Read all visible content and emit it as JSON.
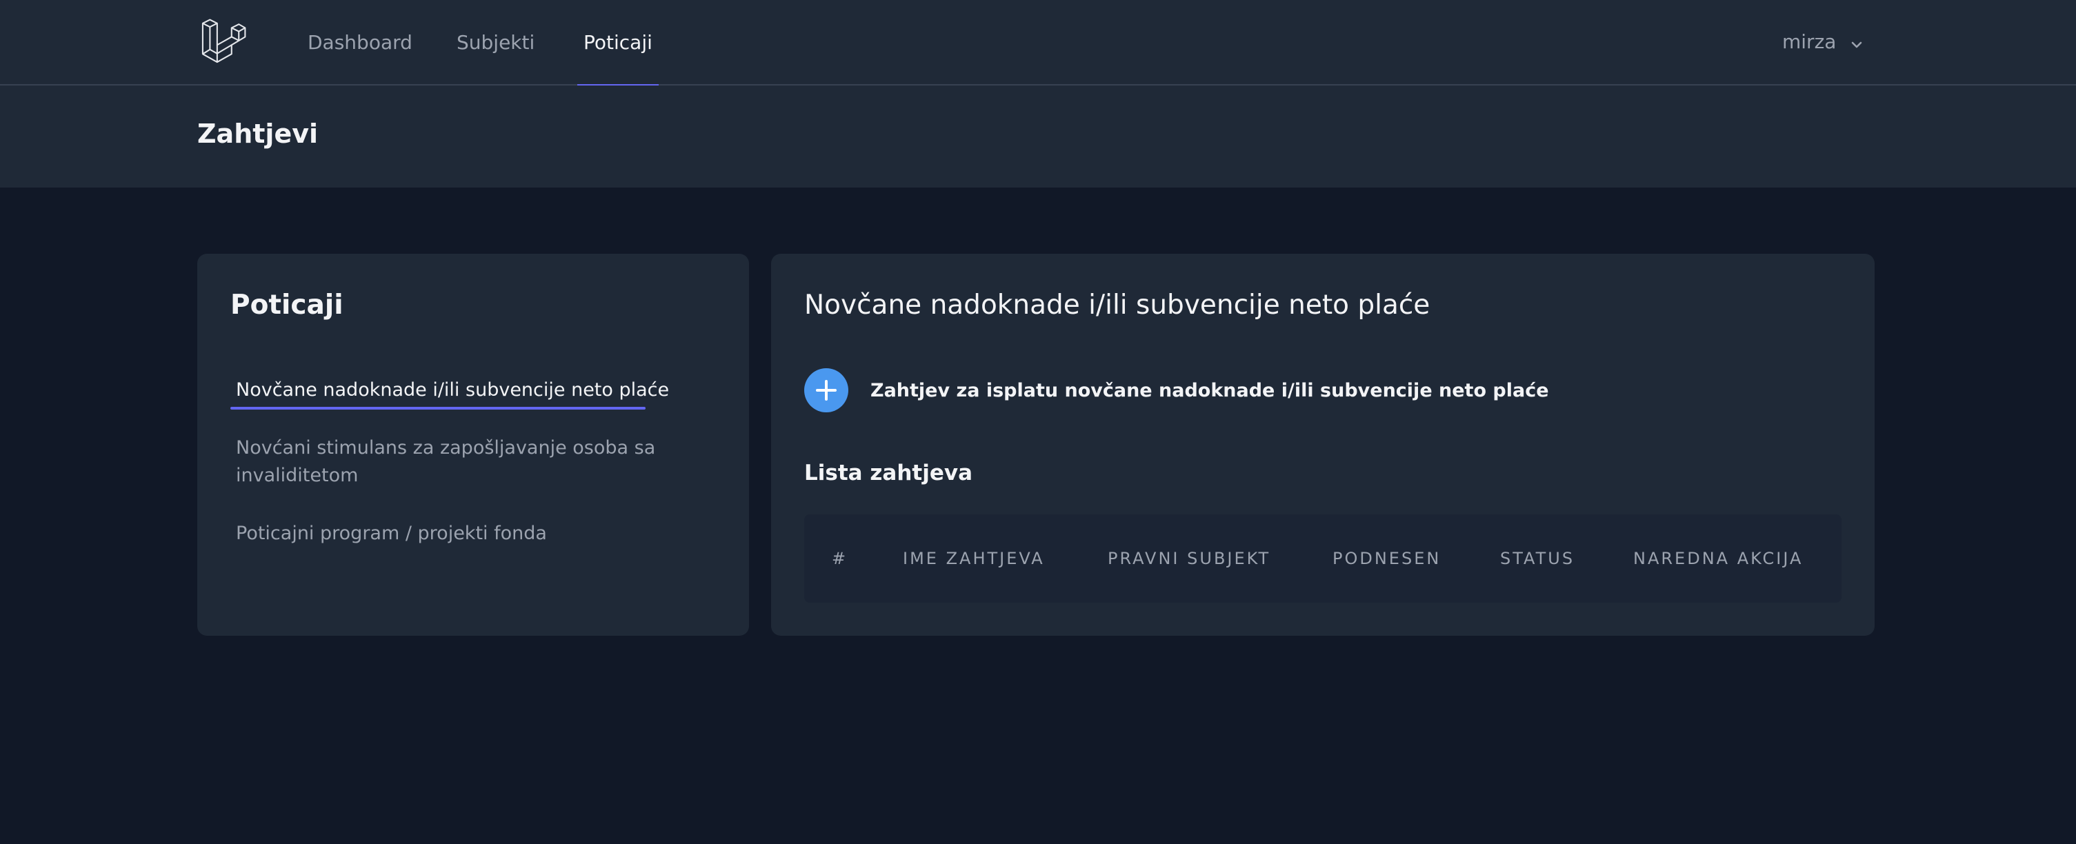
{
  "nav": {
    "links": [
      {
        "label": "Dashboard",
        "active": false
      },
      {
        "label": "Subjekti",
        "active": false
      },
      {
        "label": "Poticaji",
        "active": true
      }
    ],
    "user": "mirza",
    "logo_icon": "laravel-logo-icon"
  },
  "header": {
    "title": "Zahtjevi"
  },
  "sidebar": {
    "title": "Poticaji",
    "items": [
      {
        "label": "Novčane nadoknade i/ili subvencije neto plaće",
        "active": true
      },
      {
        "label": "Novćani stimulans za zapošljavanje osoba sa invaliditetom",
        "active": false
      },
      {
        "label": "Poticajni program / projekti fonda",
        "active": false
      }
    ]
  },
  "main": {
    "title": "Novčane nadoknade i/ili subvencije neto plaće",
    "add_label": "Zahtjev za isplatu novčane nadoknade i/ili subvencije neto plaće",
    "add_icon": "plus-icon",
    "list_title": "Lista zahtjeva",
    "columns": [
      "#",
      "IME ZAHTJEVA",
      "PRAVNI SUBJEKT",
      "PODNESEN",
      "STATUS",
      "NAREDNA AKCIJA"
    ]
  },
  "colors": {
    "background": "#111827",
    "surface": "#1f2937",
    "accent": "#6366f1",
    "button": "#4a98ef"
  }
}
